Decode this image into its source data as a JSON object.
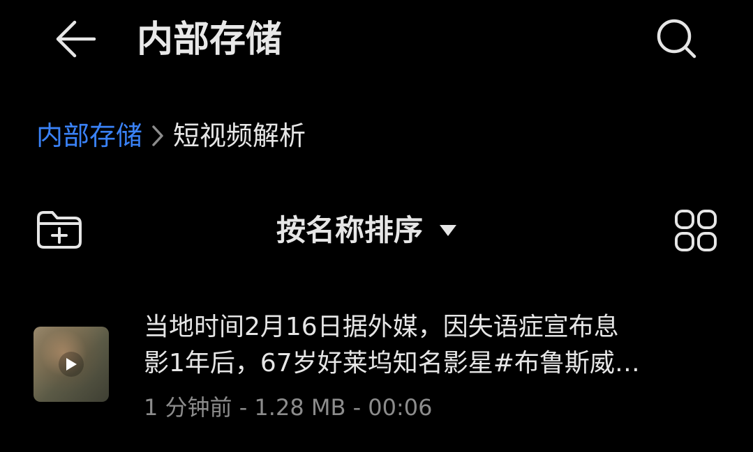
{
  "header": {
    "title": "内部存储",
    "back_icon": "arrow-left-icon",
    "search_icon": "search-icon"
  },
  "breadcrumb": {
    "root": "内部存储",
    "separator_icon": "chevron-right-icon",
    "current": "短视频解析"
  },
  "toolbar": {
    "new_folder_icon": "folder-add-icon",
    "sort_label": "按名称排序",
    "sort_caret_icon": "caret-down-icon",
    "view_icon": "grid-view-icon"
  },
  "files": [
    {
      "name_line1": "当地时间2月16日据外媒，因失语症宣布息",
      "name_line2": "影1年后，67岁好莱坞知名影星#布鲁斯威…",
      "meta": "1 分钟前 - 1.28 MB - 00:06",
      "type_icon": "play-icon"
    }
  ],
  "colors": {
    "background": "#000000",
    "text_primary": "#e6e6e6",
    "text_secondary": "#8c8c8c",
    "accent": "#3a82f7"
  }
}
